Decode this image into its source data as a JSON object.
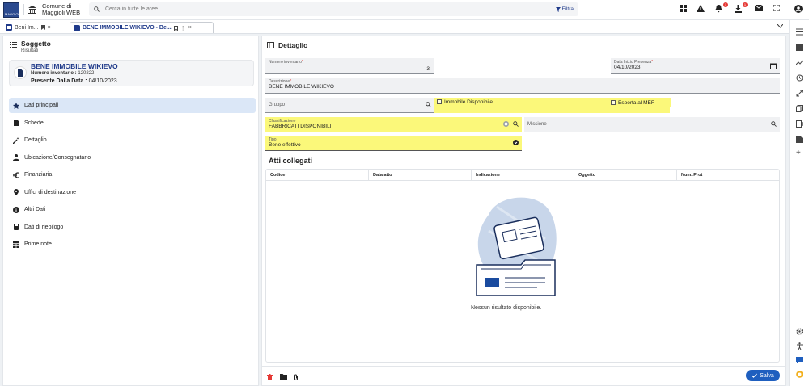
{
  "app": {
    "org_name": "Comune di Maggioli WEB",
    "logo_text": "MAGGIOLI"
  },
  "search": {
    "placeholder": "Cerca in tutte le aree...",
    "filter_label": "Filtra"
  },
  "notifications": {
    "bell_count": "1",
    "download_count": "1"
  },
  "tabs": [
    {
      "label": "Beni Im..."
    },
    {
      "label": "BENE IMMOBILE WIKIEVO - Be..."
    }
  ],
  "left": {
    "title": "Soggetto",
    "subtitle": "Risultati",
    "card": {
      "name": "BENE IMMOBILE WIKIEVO",
      "inv_label": "Numero inventario :",
      "inv_value": "120222",
      "date_label": "Presente Dalla Data :",
      "date_value": "04/10/2023"
    },
    "menu": [
      {
        "label": "Dati principali",
        "icon": "star-icon"
      },
      {
        "label": "Schede",
        "icon": "document-icon"
      },
      {
        "label": "Dettaglio",
        "icon": "magic-wand-icon"
      },
      {
        "label": "Ubicazione/Consegnatario",
        "icon": "person-icon"
      },
      {
        "label": "Finanziaria",
        "icon": "euro-icon"
      },
      {
        "label": "Uffici di destinazione",
        "icon": "map-pin-icon"
      },
      {
        "label": "Altri Dati",
        "icon": "info-icon"
      },
      {
        "label": "Dati di riepilogo",
        "icon": "calculator-icon"
      },
      {
        "label": "Prime note",
        "icon": "table-icon"
      }
    ]
  },
  "detail": {
    "title": "Dettaglio",
    "numero_inventario": {
      "label": "Numero inventario",
      "value": "3"
    },
    "data_inizio": {
      "label": "Data Inizio Presenza",
      "value": "04/10/2023"
    },
    "descrizione": {
      "label": "Descrizione",
      "value": "BENE IMMOBILE WIKIEVO"
    },
    "gruppo": {
      "placeholder": "Gruppo"
    },
    "immobile_disponibile": {
      "label": "Immobile Disponibile"
    },
    "esporta_mef": {
      "label": "Esporta al MEF"
    },
    "classificazione": {
      "label": "Classificazione",
      "value": "FABBRICATI DISPONIBILI"
    },
    "missione": {
      "placeholder": "Missione"
    },
    "tipo": {
      "label": "Tipo",
      "value": "Bene effettivo"
    },
    "required_mark": "*"
  },
  "atti": {
    "title": "Atti collegati",
    "columns": [
      "Codice",
      "Data atto",
      "Indicazione",
      "Oggetto",
      "Num. Prot"
    ],
    "empty_text": "Nessun risultato disponibile."
  },
  "footer": {
    "save_label": "Salva"
  },
  "colors": {
    "accent": "#1f3a8a",
    "highlight": "#fbf87a",
    "save": "#1f5fbf"
  }
}
